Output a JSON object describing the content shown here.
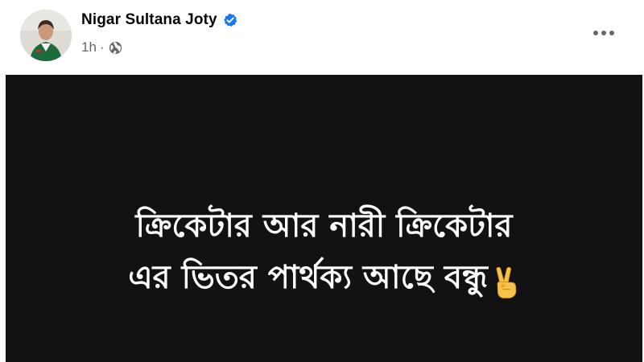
{
  "post": {
    "author_name": "Nigar Sultana Joty",
    "time": "1h",
    "separator": "·",
    "verified_icon": "verified-badge-icon",
    "privacy_icon": "globe-icon",
    "menu_icon": "more-horizontal-icon",
    "text_lines": [
      "ক্রিকেটার আর নারী ক্রিকেটার",
      "এর ভিতর পার্থক্য আছে বন্ধু"
    ],
    "emoji": "victory-hand-emoji",
    "background_color": "#121212",
    "text_color": "#ffffff",
    "verified_color": "#1877f2"
  }
}
